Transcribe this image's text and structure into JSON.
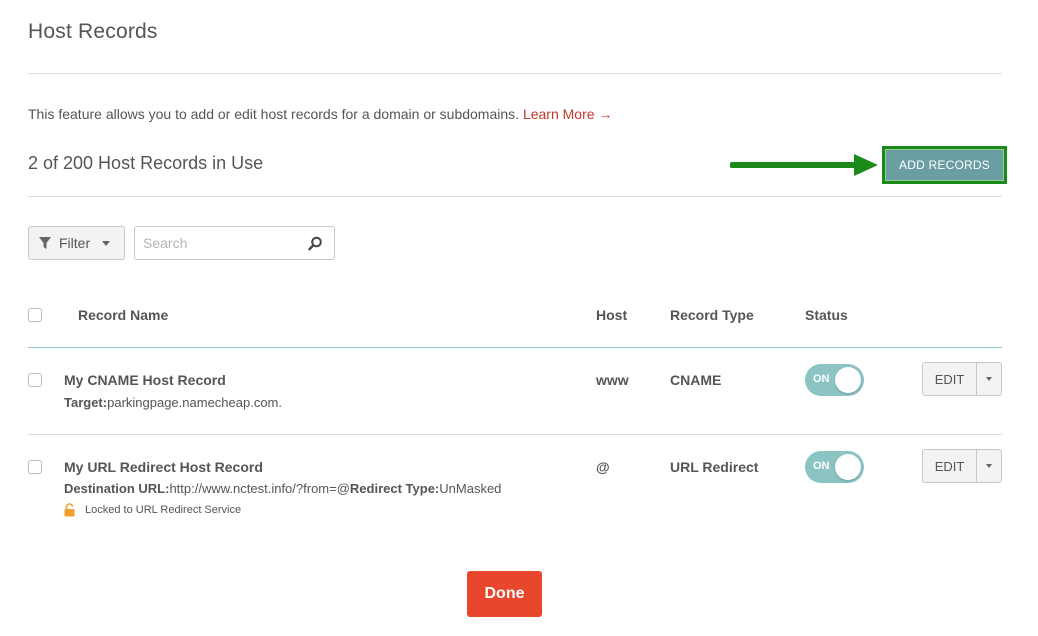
{
  "page": {
    "title": "Host Records",
    "intro_text": "This feature allows you to add or edit host records for a domain or subdomains.",
    "learn_more": "Learn More →",
    "usage_text": "2 of 200 Host Records in Use"
  },
  "toolbar": {
    "add_records_label": "ADD RECORDS",
    "filter_label": "Filter",
    "search_placeholder": "Search"
  },
  "table": {
    "headers": {
      "record_name": "Record Name",
      "host": "Host",
      "record_type": "Record Type",
      "status": "Status"
    },
    "rows": [
      {
        "name": "My CNAME Host Record",
        "detail_label": "Target:",
        "detail_value": "parkingpage.namecheap.com.",
        "host": "www",
        "type": "CNAME",
        "status": "ON",
        "edit_label": "EDIT"
      },
      {
        "name": "My URL Redirect Host Record",
        "detail_label": "Destination URL:",
        "detail_value": "http://www.nctest.info/?from=@",
        "detail_label_2": "Redirect Type:",
        "detail_value_2": "UnMasked",
        "locked_text": "Locked to URL Redirect Service",
        "host": "@",
        "type": "URL Redirect",
        "status": "ON",
        "edit_label": "EDIT"
      }
    ]
  },
  "footer": {
    "done_label": "Done"
  },
  "colors": {
    "accent_link": "#c0392b",
    "toggle_on": "#8cc4c4",
    "add_button": "#6b9ea3",
    "highlight_border": "#1b8a1b",
    "done_button": "#e8472d"
  },
  "icons": [
    "filter-funnel-icon",
    "search-icon",
    "chevron-down-icon",
    "lock-icon",
    "green-arrow-annotation"
  ]
}
